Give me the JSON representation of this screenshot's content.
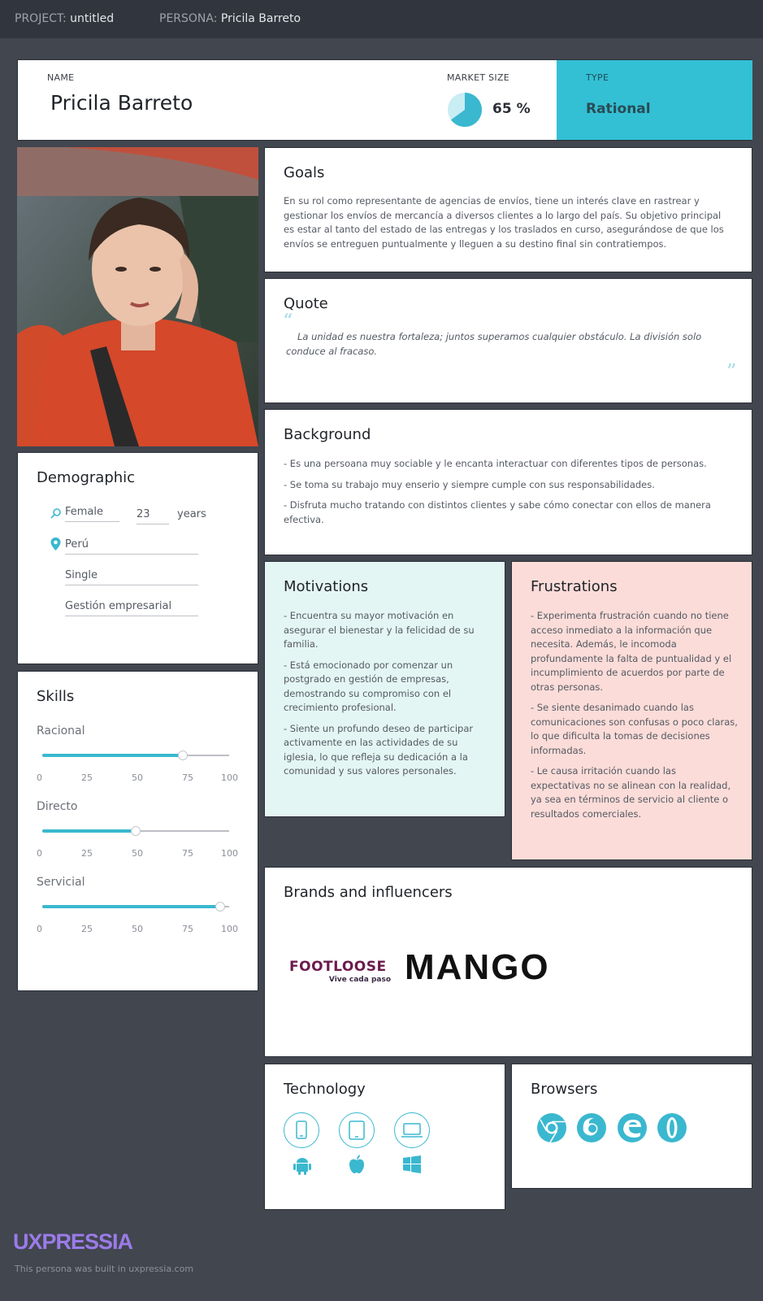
{
  "topbar": {
    "project_label": "PROJECT:",
    "project_value": "untitled",
    "persona_label": "PERSONA:",
    "persona_value": "Pricila Barreto"
  },
  "header": {
    "name_label": "NAME",
    "name": "Pricila Barreto",
    "market_label": "MARKET SIZE",
    "market_value": "65 %",
    "market_percent": 65,
    "type_label": "TYPE",
    "type_value": "Rational"
  },
  "goals": {
    "title": "Goals",
    "text": "En su rol como representante de agencias de envíos, tiene un interés clave en rastrear y gestionar los envíos de mercancía a diversos clientes a lo largo del país. Su objetivo principal es estar al tanto del estado de las entregas y los traslados en curso, asegurándose de que los envíos se entreguen puntualmente y lleguen a su destino final sin contratiempos."
  },
  "quote": {
    "title": "Quote",
    "text": "La unidad es nuestra fortaleza; juntos superamos cualquier obstáculo. La división solo conduce al fracaso."
  },
  "background": {
    "title": "Background",
    "items": [
      "- Es una persoana muy sociable y le encanta interactuar con diferentes tipos de personas.",
      "- Se toma su trabajo muy enserio y siempre cumple con sus responsabilidades.",
      "- Disfruta mucho tratando con distintos clientes y sabe cómo conectar con ellos de manera efectiva."
    ]
  },
  "demographic": {
    "title": "Demographic",
    "gender": "Female",
    "age": "23",
    "age_unit": "years",
    "location": "Perú",
    "status": "Single",
    "occupation": "Gestión empresarial"
  },
  "skills": {
    "title": "Skills",
    "ticks": [
      "0",
      "25",
      "50",
      "75",
      "100"
    ],
    "items": [
      {
        "label": "Racional",
        "value": 75
      },
      {
        "label": "Directo",
        "value": 50
      },
      {
        "label": "Servicial",
        "value": 95
      }
    ]
  },
  "motivations": {
    "title": "Motivations",
    "items": [
      "- Encuentra su mayor motivación en asegurar el bienestar y la felicidad de su familia.",
      "- Está emocionado por comenzar un postgrado en gestión de empresas, demostrando su compromiso con el crecimiento profesional.",
      "- Siente un profundo deseo de participar activamente en las actividades de su iglesia, lo que refleja su dedicación a la comunidad y sus valores personales."
    ]
  },
  "frustrations": {
    "title": "Frustrations",
    "items": [
      "- Experimenta frustración cuando no tiene acceso inmediato a la información que necesita. Además, le incomoda profundamente la falta de puntualidad y el incumplimiento de acuerdos por parte de otras personas.",
      "- Se siente desanimado cuando las comunicaciones son confusas o poco claras, lo que dificulta la tomas de decisiones informadas.",
      "- Le causa irritación cuando las expectativas no se alinean con la realidad, ya sea en términos de servicio al cliente o resultados comerciales."
    ]
  },
  "brands": {
    "title": "Brands and influencers",
    "footloose": "FOOTLOOSE",
    "footloose_tagline": "Vive cada paso",
    "mango": "MANGO"
  },
  "technology": {
    "title": "Technology"
  },
  "browsers": {
    "title": "Browsers"
  },
  "footer": {
    "logo": "UXPRESSIA",
    "note": "This persona was built in uxpressia.com"
  },
  "colors": {
    "accent": "#3ab8cf",
    "type_bg": "#33c0d4",
    "motivations_bg": "#e4f6f3",
    "frustrations_bg": "#fbdcd8",
    "page_bg": "#41464f",
    "logo": "#9b7be8"
  }
}
